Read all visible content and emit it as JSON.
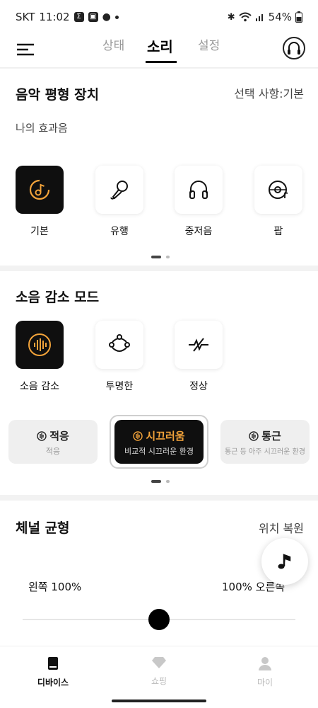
{
  "status_bar": {
    "carrier": "SKT",
    "time": "11:02",
    "battery": "54%"
  },
  "header": {
    "tabs": [
      {
        "label": "상태"
      },
      {
        "label": "소리"
      },
      {
        "label": "설정"
      }
    ]
  },
  "equalizer": {
    "title": "음악 평형 장치",
    "selection": "선택 사항:기본",
    "subtitle": "나의 효과음",
    "presets": [
      {
        "label": "기본",
        "icon": "music-disc-icon"
      },
      {
        "label": "유행",
        "icon": "microphone-icon"
      },
      {
        "label": "중저음",
        "icon": "headphones-icon"
      },
      {
        "label": "팝",
        "icon": "vinyl-icon"
      }
    ]
  },
  "noise": {
    "title": "소음 감소 모드",
    "modes": [
      {
        "label": "소음 감소",
        "icon": "soundwave-icon"
      },
      {
        "label": "투명한",
        "icon": "transparency-icon"
      },
      {
        "label": "정상",
        "icon": "normal-icon"
      }
    ],
    "levels": [
      {
        "title": "적응",
        "sub": "적응"
      },
      {
        "title": "시끄러움",
        "sub": "비교적 시끄러운 환경"
      },
      {
        "title": "통근",
        "sub": "통근 등 아주 시끄러운 환경"
      }
    ]
  },
  "balance": {
    "title": "체널 균형",
    "reset": "위치 복원",
    "left": "왼쪽 100%",
    "right": "100% 오른쪽",
    "position": 0.5
  },
  "bottom_nav": [
    {
      "label": "디바이스"
    },
    {
      "label": "쇼핑"
    },
    {
      "label": "마이"
    }
  ],
  "colors": {
    "accent": "#f2a33a",
    "active_tile": "#0f0f0f"
  }
}
